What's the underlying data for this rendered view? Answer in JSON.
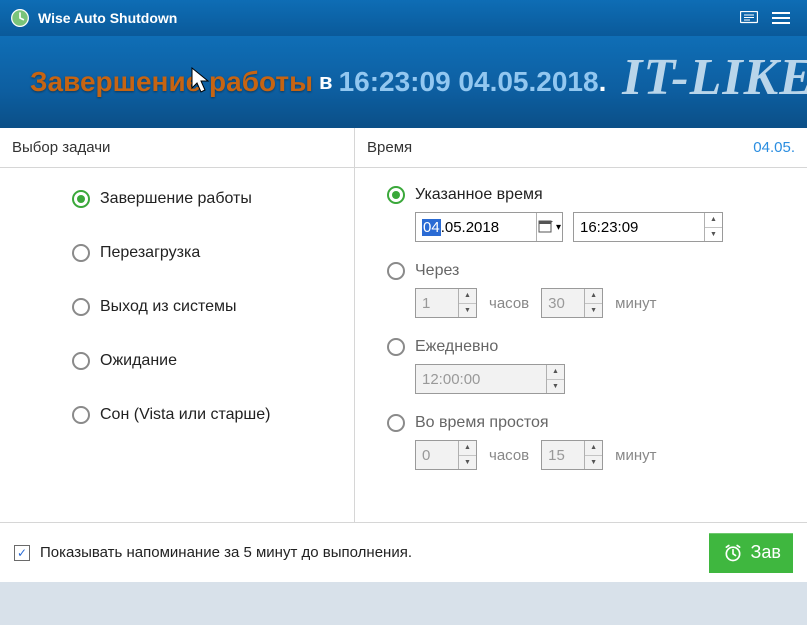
{
  "title_bar": {
    "app_name": "Wise Auto Shutdown"
  },
  "banner": {
    "line1": "Завершение работы",
    "line_mid": "в",
    "line2": "16:23:09 04.05.2018",
    "watermark": "IT-LIKE"
  },
  "sections": {
    "tasks_header": "Выбор задачи",
    "time_header": "Время",
    "header_date": "04.05."
  },
  "tasks": [
    {
      "label": "Завершение работы",
      "checked": true
    },
    {
      "label": "Перезагрузка",
      "checked": false
    },
    {
      "label": "Выход из системы",
      "checked": false
    },
    {
      "label": "Ожидание",
      "checked": false
    },
    {
      "label": "Сон (Vista или старше)",
      "checked": false
    }
  ],
  "time_options": {
    "specified": {
      "label": "Указанное время",
      "checked": true,
      "date_sel": "04",
      "date_rest": ".05.2018",
      "time": "16:23:09"
    },
    "after": {
      "label": "Через",
      "hours": "1",
      "hours_unit": "часов",
      "minutes": "30",
      "minutes_unit": "минут"
    },
    "daily": {
      "label": "Ежедневно",
      "time": "12:00:00"
    },
    "idle": {
      "label": "Во время простоя",
      "hours": "0",
      "hours_unit": "часов",
      "minutes": "15",
      "minutes_unit": "минут"
    }
  },
  "footer": {
    "reminder_label": "Показывать напоминание за 5 минут до выполнения.",
    "reminder_checked": true,
    "start_label": "Зав"
  }
}
